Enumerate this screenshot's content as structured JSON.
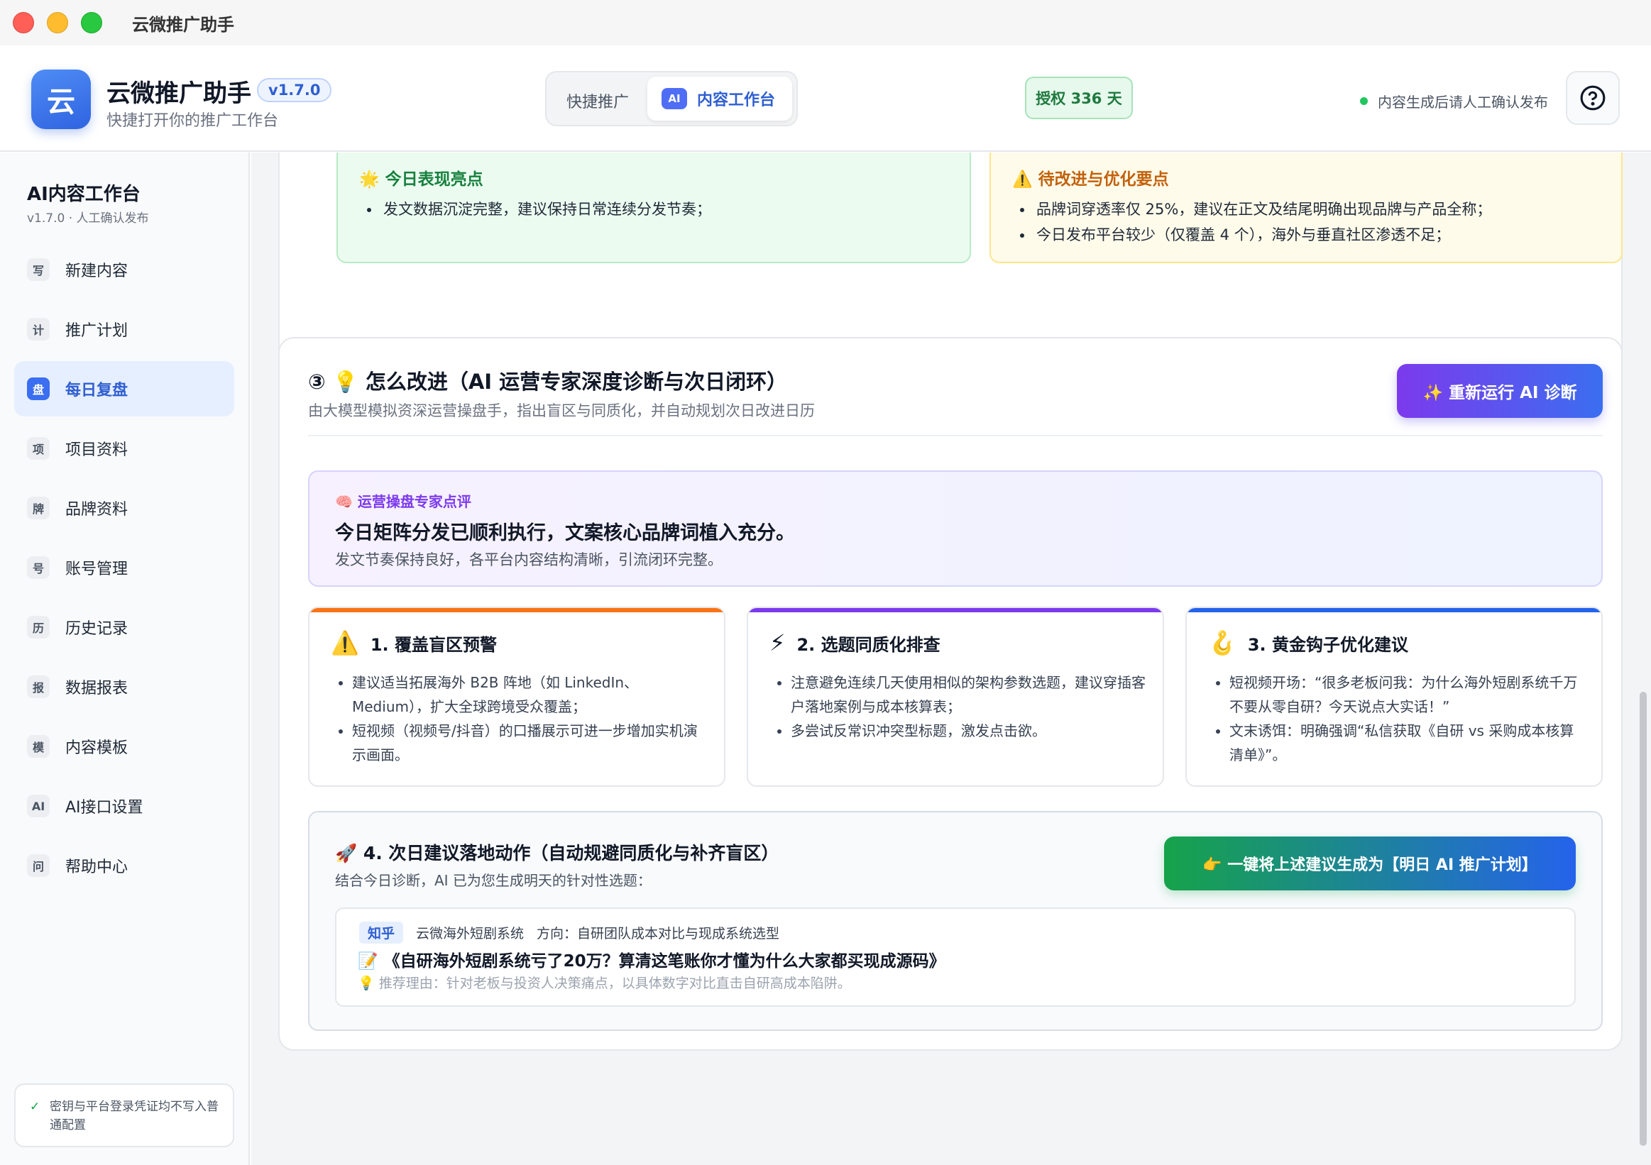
{
  "window": {
    "title": "云微推广助手"
  },
  "header": {
    "logo_char": "云",
    "app_name": "云微推广助手",
    "version": "v1.7.0",
    "subtitle": "快捷打开你的推广工作台",
    "mode_quick": "快捷推广",
    "mode_ai_chip": "AI",
    "mode_active": "内容工作台",
    "license": "授权 336 天",
    "notice": "内容生成后请人工确认发布",
    "help_icon": "question-circle-icon"
  },
  "sidebar": {
    "title": "AI内容工作台",
    "subtitle": "v1.7.0 · 人工确认发布",
    "items": [
      {
        "icon": "写",
        "label": "新建内容",
        "active": false
      },
      {
        "icon": "计",
        "label": "推广计划",
        "active": false
      },
      {
        "icon": "盘",
        "label": "每日复盘",
        "active": true
      },
      {
        "icon": "项",
        "label": "项目资料",
        "active": false
      },
      {
        "icon": "牌",
        "label": "品牌资料",
        "active": false
      },
      {
        "icon": "号",
        "label": "账号管理",
        "active": false
      },
      {
        "icon": "历",
        "label": "历史记录",
        "active": false
      },
      {
        "icon": "报",
        "label": "数据报表",
        "active": false
      },
      {
        "icon": "模",
        "label": "内容模板",
        "active": false
      },
      {
        "icon": "AI",
        "label": "AI接口设置",
        "active": false
      },
      {
        "icon": "问",
        "label": "帮助中心",
        "active": false
      }
    ],
    "footer": "密钥与平台登录凭证均不写入普通配置"
  },
  "highlights": {
    "good_title": "🌟 今日表现亮点",
    "good_items": [
      "发文数据沉淀完整，建议保持日常连续分发节奏；"
    ],
    "warn_title": "⚠️ 待改进与优化要点",
    "warn_items": [
      "品牌词穿透率仅 25%，建议在正文及结尾明确出现品牌与产品全称；",
      "今日发布平台较少（仅覆盖 4 个），海外与垂直社区渗透不足；"
    ]
  },
  "improve": {
    "title": "③ 💡 怎么改进（AI 运营专家深度诊断与次日闭环）",
    "subtitle": "由大模型模拟资深运营操盘手，指出盲区与同质化，并自动规划次日改进日历",
    "rerun_button": "✨ 重新运行 AI 诊断",
    "expert": {
      "tag": "🧠 运营操盘专家点评",
      "main": "今日矩阵分发已顺利执行，文案核心品牌词植入充分。",
      "sub": "发文节奏保持良好，各平台内容结构清晰，引流闭环完整。"
    },
    "cards": [
      {
        "icon": "⚠️",
        "title": "1. 覆盖盲区预警",
        "color": "#f97316",
        "items": [
          "建议适当拓展海外 B2B 阵地（如 LinkedIn、Medium），扩大全球跨境受众覆盖；",
          "短视频（视频号/抖音）的口播展示可进一步增加实机演示画面。"
        ]
      },
      {
        "icon": "⚡",
        "title": "2. 选题同质化排查",
        "color": "#7c3aed",
        "items": [
          "注意避免连续几天使用相似的架构参数选题，建议穿插客户落地案例与成本核算表；",
          "多尝试反常识冲突型标题，激发点击欲。"
        ]
      },
      {
        "icon": "🪝",
        "title": "3. 黄金钩子优化建议",
        "color": "#2563eb",
        "items": [
          "短视频开场：“很多老板问我：为什么海外短剧系统千万不要从零自研？今天说点大实话！”",
          "文末诱饵：明确强调“私信获取《自研 vs 采购成本核算清单》”。"
        ]
      }
    ],
    "action": {
      "title": "🚀 4. 次日建议落地动作（自动规避同质化与补齐盲区）",
      "subtitle": "结合今日诊断，AI 已为您生成明天的针对性选题：",
      "button": "👉 一键将上述建议生成为【明日 AI 推广计划】",
      "topic": {
        "platform": "知乎",
        "account": "云微海外短剧系统",
        "direction": "方向：自研团队成本对比与现成系统选型",
        "title": "📝 《自研海外短剧系统亏了20万？算清这笔账你才懂为什么大家都买现成源码》",
        "reason": "💡 推荐理由：针对老板与投资人决策痛点，以具体数字对比直击自研高成本陷阱。"
      }
    }
  },
  "colors": {
    "accent": "#3b6ef0",
    "good_bg": "#ecfbf0",
    "warn_bg": "#fffbea"
  }
}
